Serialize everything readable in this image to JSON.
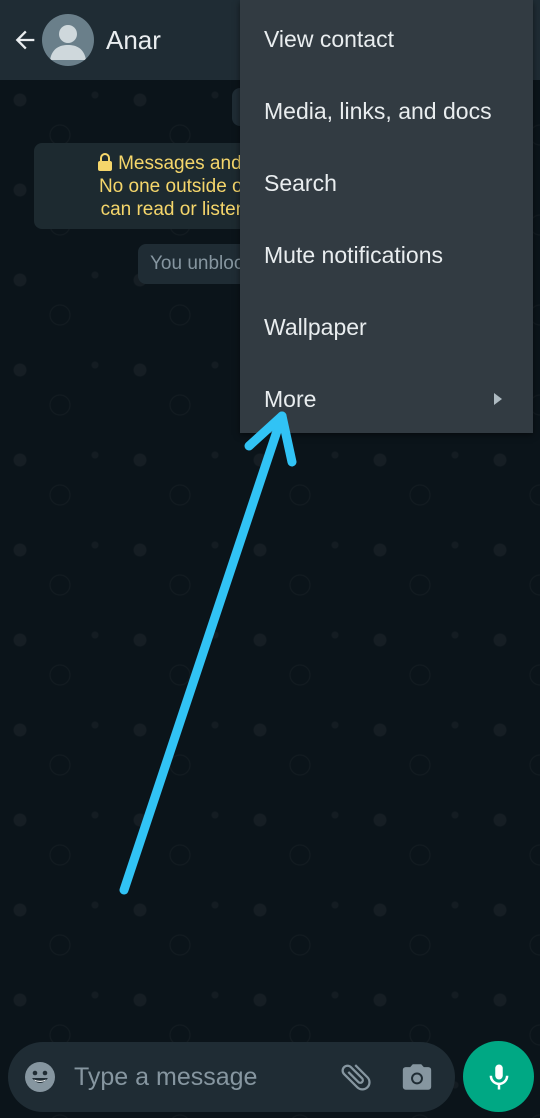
{
  "header": {
    "contact_name": "Anar",
    "back_icon": "arrow-left-icon",
    "avatar_icon": "default-avatar-icon"
  },
  "chat": {
    "encryption_notice": {
      "icon": "lock-icon",
      "lines": [
        "Messages and cal",
        "No one outside of th",
        "can read or listen to"
      ]
    },
    "system_message": "You unbloc"
  },
  "menu": {
    "items": [
      {
        "label": "View contact"
      },
      {
        "label": "Media, links, and docs"
      },
      {
        "label": "Search"
      },
      {
        "label": "Mute notifications"
      },
      {
        "label": "Wallpaper"
      },
      {
        "label": "More",
        "submenu_icon": "triangle-right-icon"
      }
    ]
  },
  "annotation": {
    "type": "arrow",
    "color": "#31c3f5",
    "points_to": "More"
  },
  "composer": {
    "placeholder": "Type a message",
    "value": "",
    "emoji_icon": "emoji-icon",
    "attach_icon": "paperclip-icon",
    "camera_icon": "camera-icon",
    "mic_icon": "microphone-icon"
  },
  "colors": {
    "header_bg": "#1f2c34",
    "chat_bg": "#0b141a",
    "menu_bg": "#323b42",
    "notice_text": "#f5d66b",
    "accent": "#00a884"
  }
}
